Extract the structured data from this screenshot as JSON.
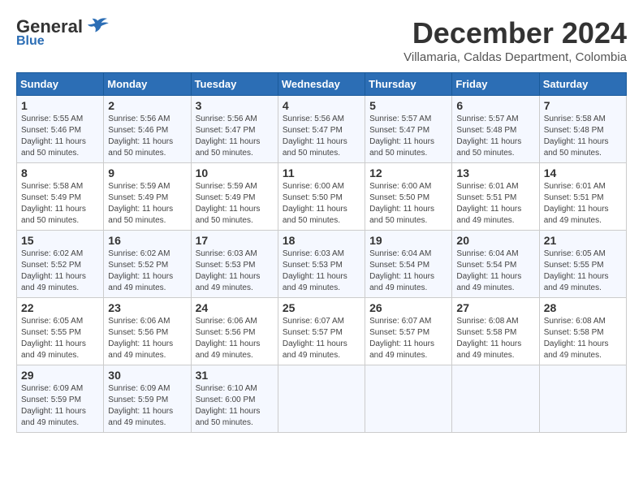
{
  "logo": {
    "general": "General",
    "blue": "Blue"
  },
  "title": "December 2024",
  "location": "Villamaria, Caldas Department, Colombia",
  "weekdays": [
    "Sunday",
    "Monday",
    "Tuesday",
    "Wednesday",
    "Thursday",
    "Friday",
    "Saturday"
  ],
  "weeks": [
    [
      {
        "day": "1",
        "sunrise": "5:55 AM",
        "sunset": "5:46 PM",
        "daylight": "11 hours and 50 minutes."
      },
      {
        "day": "2",
        "sunrise": "5:56 AM",
        "sunset": "5:46 PM",
        "daylight": "11 hours and 50 minutes."
      },
      {
        "day": "3",
        "sunrise": "5:56 AM",
        "sunset": "5:47 PM",
        "daylight": "11 hours and 50 minutes."
      },
      {
        "day": "4",
        "sunrise": "5:56 AM",
        "sunset": "5:47 PM",
        "daylight": "11 hours and 50 minutes."
      },
      {
        "day": "5",
        "sunrise": "5:57 AM",
        "sunset": "5:47 PM",
        "daylight": "11 hours and 50 minutes."
      },
      {
        "day": "6",
        "sunrise": "5:57 AM",
        "sunset": "5:48 PM",
        "daylight": "11 hours and 50 minutes."
      },
      {
        "day": "7",
        "sunrise": "5:58 AM",
        "sunset": "5:48 PM",
        "daylight": "11 hours and 50 minutes."
      }
    ],
    [
      {
        "day": "8",
        "sunrise": "5:58 AM",
        "sunset": "5:49 PM",
        "daylight": "11 hours and 50 minutes."
      },
      {
        "day": "9",
        "sunrise": "5:59 AM",
        "sunset": "5:49 PM",
        "daylight": "11 hours and 50 minutes."
      },
      {
        "day": "10",
        "sunrise": "5:59 AM",
        "sunset": "5:49 PM",
        "daylight": "11 hours and 50 minutes."
      },
      {
        "day": "11",
        "sunrise": "6:00 AM",
        "sunset": "5:50 PM",
        "daylight": "11 hours and 50 minutes."
      },
      {
        "day": "12",
        "sunrise": "6:00 AM",
        "sunset": "5:50 PM",
        "daylight": "11 hours and 50 minutes."
      },
      {
        "day": "13",
        "sunrise": "6:01 AM",
        "sunset": "5:51 PM",
        "daylight": "11 hours and 49 minutes."
      },
      {
        "day": "14",
        "sunrise": "6:01 AM",
        "sunset": "5:51 PM",
        "daylight": "11 hours and 49 minutes."
      }
    ],
    [
      {
        "day": "15",
        "sunrise": "6:02 AM",
        "sunset": "5:52 PM",
        "daylight": "11 hours and 49 minutes."
      },
      {
        "day": "16",
        "sunrise": "6:02 AM",
        "sunset": "5:52 PM",
        "daylight": "11 hours and 49 minutes."
      },
      {
        "day": "17",
        "sunrise": "6:03 AM",
        "sunset": "5:53 PM",
        "daylight": "11 hours and 49 minutes."
      },
      {
        "day": "18",
        "sunrise": "6:03 AM",
        "sunset": "5:53 PM",
        "daylight": "11 hours and 49 minutes."
      },
      {
        "day": "19",
        "sunrise": "6:04 AM",
        "sunset": "5:54 PM",
        "daylight": "11 hours and 49 minutes."
      },
      {
        "day": "20",
        "sunrise": "6:04 AM",
        "sunset": "5:54 PM",
        "daylight": "11 hours and 49 minutes."
      },
      {
        "day": "21",
        "sunrise": "6:05 AM",
        "sunset": "5:55 PM",
        "daylight": "11 hours and 49 minutes."
      }
    ],
    [
      {
        "day": "22",
        "sunrise": "6:05 AM",
        "sunset": "5:55 PM",
        "daylight": "11 hours and 49 minutes."
      },
      {
        "day": "23",
        "sunrise": "6:06 AM",
        "sunset": "5:56 PM",
        "daylight": "11 hours and 49 minutes."
      },
      {
        "day": "24",
        "sunrise": "6:06 AM",
        "sunset": "5:56 PM",
        "daylight": "11 hours and 49 minutes."
      },
      {
        "day": "25",
        "sunrise": "6:07 AM",
        "sunset": "5:57 PM",
        "daylight": "11 hours and 49 minutes."
      },
      {
        "day": "26",
        "sunrise": "6:07 AM",
        "sunset": "5:57 PM",
        "daylight": "11 hours and 49 minutes."
      },
      {
        "day": "27",
        "sunrise": "6:08 AM",
        "sunset": "5:58 PM",
        "daylight": "11 hours and 49 minutes."
      },
      {
        "day": "28",
        "sunrise": "6:08 AM",
        "sunset": "5:58 PM",
        "daylight": "11 hours and 49 minutes."
      }
    ],
    [
      {
        "day": "29",
        "sunrise": "6:09 AM",
        "sunset": "5:59 PM",
        "daylight": "11 hours and 49 minutes."
      },
      {
        "day": "30",
        "sunrise": "6:09 AM",
        "sunset": "5:59 PM",
        "daylight": "11 hours and 49 minutes."
      },
      {
        "day": "31",
        "sunrise": "6:10 AM",
        "sunset": "6:00 PM",
        "daylight": "11 hours and 50 minutes."
      },
      null,
      null,
      null,
      null
    ]
  ]
}
